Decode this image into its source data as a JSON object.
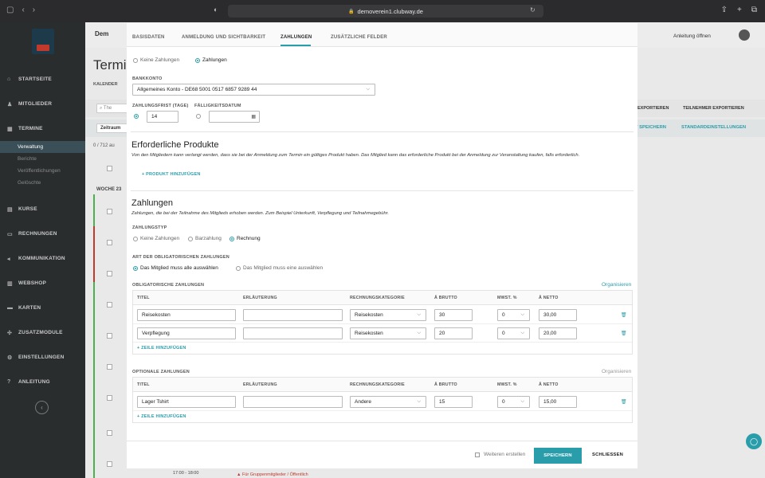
{
  "browser": {
    "url": "demoverein1.clubway.de"
  },
  "sidebar": {
    "items": [
      {
        "label": "STARTSEITE",
        "icon": "home-icon"
      },
      {
        "label": "MITGLIEDER",
        "icon": "user-icon"
      },
      {
        "label": "TERMINE",
        "icon": "calendar-icon"
      },
      {
        "label": "KURSE",
        "icon": "courses-icon"
      },
      {
        "label": "RECHNUNGEN",
        "icon": "invoice-icon"
      },
      {
        "label": "KOMMUNIKATION",
        "icon": "megaphone-icon"
      },
      {
        "label": "WEBSHOP",
        "icon": "cart-icon"
      },
      {
        "label": "KARTEN",
        "icon": "card-icon"
      },
      {
        "label": "ZUSATZMODULE",
        "icon": "puzzle-icon"
      },
      {
        "label": "EINSTELLUNGEN",
        "icon": "gear-icon"
      },
      {
        "label": "ANLEITUNG",
        "icon": "help-icon"
      }
    ],
    "termine_sub": [
      "Verwaltung",
      "Berichte",
      "Veröffentlichungen",
      "Gelöschte"
    ]
  },
  "background": {
    "title": "Termi",
    "org_name": "Dem",
    "kalender": "KALENDER",
    "anleitung": "Anleitung öffnen",
    "export1": "EXPORTIEREN",
    "export2": "TEILNEHMER EXPORTIEREN",
    "filter_save": "T SPEICHERN",
    "filter_default": "STANDARDEINSTELLUNGEN",
    "zeitraum": "Zeitraum",
    "search": "The",
    "count": "0 / 712 au",
    "week": "WOCHE 23",
    "time": "17:00 - 18:00",
    "warning": "Für Gruppenmitglieder / Öffentlich"
  },
  "modal": {
    "tabs": [
      "BASISDATEN",
      "ANMELDUNG UND SICHTBARKEIT",
      "ZAHLUNGEN",
      "ZUSÄTZLICHE FELDER"
    ],
    "payment_mode": {
      "opt1": "Keine Zahlungen",
      "opt2": "Zahlungen"
    },
    "bank": {
      "label": "BANKKONTO",
      "value": "Allgemeines Konto - DE68 5001 0517 6857 9289 44"
    },
    "frist": {
      "label": "ZAHLUNGSFRIST (TAGE)",
      "value": "14"
    },
    "faellig": {
      "label": "FÄLLIGKEITSDATUM",
      "value": ""
    },
    "products": {
      "title": "Erforderliche Produkte",
      "desc": "Von den Mitgliedern kann verlangt werden, dass sie bei der Anmeldung zum Termin ein gültiges Produkt haben. Das Mitglied kann das erforderliche Produkt bei der Anmeldung zur Veranstaltung kaufen, falls erforderlich.",
      "add": "+ PRODUKT HINZUFÜGEN"
    },
    "payments": {
      "title": "Zahlungen",
      "desc": "Zahlungen, die bei der Teilnahme des Mitglieds erhoben werden. Zum Beispiel Unterkunft, Verpflegung und Teilnahmegebühr.",
      "type_label": "ZAHLUNGSTYP",
      "types": [
        "Keine Zahlungen",
        "Barzahlung",
        "Rechnung"
      ],
      "mandatory_label": "ART DER OBLIGATORISCHEN ZAHLUNGEN",
      "mandatory_opts": [
        "Das Mitglied muss alle auswählen",
        "Das Mitglied muss eine auswählen"
      ]
    },
    "columns": [
      "TITEL",
      "ERLÄUTERUNG",
      "RECHNUNGSKATEGORIE",
      "Å BRUTTO",
      "MWST. %",
      "Å NETTO"
    ],
    "obligatory": {
      "label": "OBLIGATORISCHE ZAHLUNGEN",
      "organize": "Organisieren",
      "rows": [
        {
          "titel": "Reisekosten",
          "erl": "",
          "kat": "Reisekosten",
          "brutto": "30",
          "mwst": "0",
          "netto": "30,00"
        },
        {
          "titel": "Verpflegung",
          "erl": "",
          "kat": "Reisekosten",
          "brutto": "20",
          "mwst": "0",
          "netto": "20,00"
        }
      ],
      "add": "+ ZEILE HINZUFÜGEN"
    },
    "optional": {
      "label": "OPTIONALE ZAHLUNGEN",
      "organize": "Organisieren",
      "rows": [
        {
          "titel": "Lager Tshirt",
          "erl": "",
          "kat": "Andere",
          "brutto": "15",
          "mwst": "0",
          "netto": "15,00"
        }
      ],
      "add": "+ ZEILE HINZUFÜGEN"
    },
    "footer": {
      "more": "Weiteren erstellen",
      "save": "SPEICHERN",
      "close": "SCHLIESSEN"
    }
  }
}
